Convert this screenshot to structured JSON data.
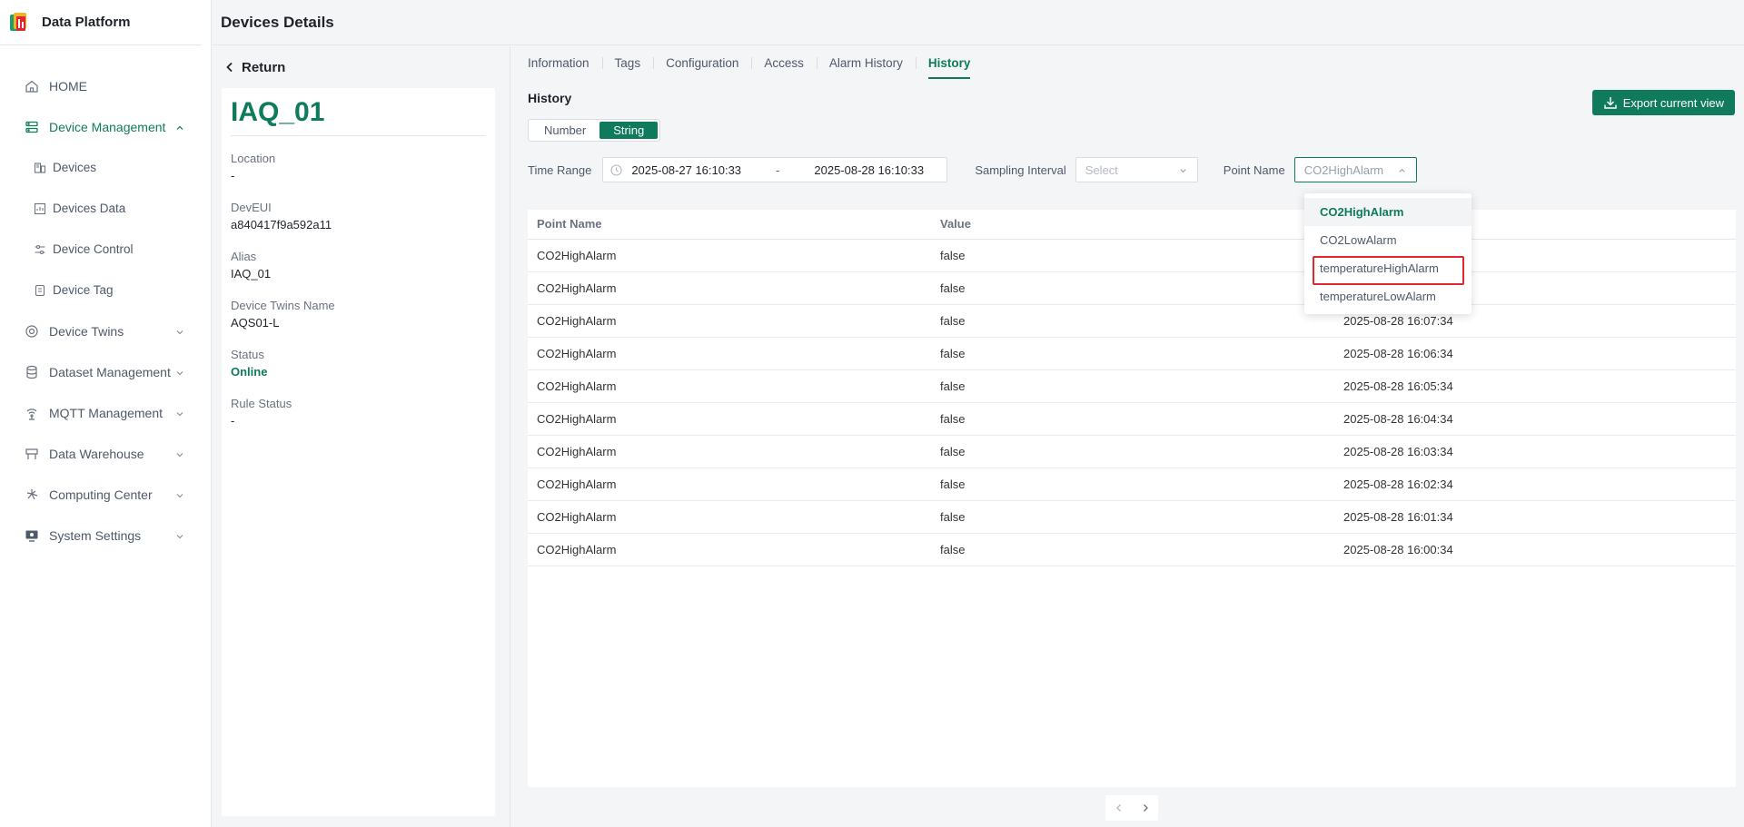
{
  "app": {
    "name": "Data Platform",
    "page_title": "Devices Details"
  },
  "colors": {
    "accent": "#0f7b5c",
    "highlight_box": "#e3262d"
  },
  "sidebar": {
    "items": [
      {
        "label": "HOME",
        "icon": "home-icon"
      },
      {
        "label": "Device Management",
        "icon": "device-management-icon",
        "active": true,
        "expanded": true,
        "children": [
          {
            "label": "Devices",
            "icon": "devices-icon"
          },
          {
            "label": "Devices Data",
            "icon": "devices-data-icon"
          },
          {
            "label": "Device Control",
            "icon": "device-control-icon"
          },
          {
            "label": "Device Tag",
            "icon": "device-tag-icon"
          }
        ]
      },
      {
        "label": "Device Twins",
        "icon": "device-twins-icon"
      },
      {
        "label": "Dataset Management",
        "icon": "dataset-icon"
      },
      {
        "label": "MQTT Management",
        "icon": "mqtt-icon"
      },
      {
        "label": "Data Warehouse",
        "icon": "warehouse-icon"
      },
      {
        "label": "Computing Center",
        "icon": "computing-icon"
      },
      {
        "label": "System Settings",
        "icon": "settings-icon"
      }
    ]
  },
  "device": {
    "return_label": "Return",
    "name": "IAQ_01",
    "fields": [
      {
        "label": "Location",
        "value": "-"
      },
      {
        "label": "DevEUI",
        "value": "a840417f9a592a11"
      },
      {
        "label": "Alias",
        "value": "IAQ_01"
      },
      {
        "label": "Device Twins Name",
        "value": "AQS01-L"
      },
      {
        "label": "Status",
        "value": "Online"
      },
      {
        "label": "Rule Status",
        "value": "-"
      }
    ]
  },
  "tabs": [
    "Information",
    "Tags",
    "Configuration",
    "Access",
    "Alarm History",
    "History"
  ],
  "active_tab": "History",
  "history": {
    "title": "History",
    "export_label": "Export current view",
    "type_options": [
      "Number",
      "String"
    ],
    "type_selected": "String",
    "time_range_label": "Time Range",
    "time_start": "2025-08-27 16:10:33",
    "time_sep": "-",
    "time_end": "2025-08-28 16:10:33",
    "sampling_label": "Sampling Interval",
    "sampling_placeholder": "Select",
    "point_name_label": "Point Name",
    "point_name_value": "CO2HighAlarm",
    "dropdown_options": [
      "CO2HighAlarm",
      "CO2LowAlarm",
      "temperatureHighAlarm",
      "temperatureLowAlarm"
    ],
    "dropdown_selected": "CO2HighAlarm",
    "dropdown_highlighted": "temperatureHighAlarm"
  },
  "table": {
    "columns": [
      "Point Name",
      "Value",
      ""
    ],
    "rows": [
      [
        "CO2HighAlarm",
        "false",
        ""
      ],
      [
        "CO2HighAlarm",
        "false",
        ""
      ],
      [
        "CO2HighAlarm",
        "false",
        "2025-08-28 16:07:34"
      ],
      [
        "CO2HighAlarm",
        "false",
        "2025-08-28 16:06:34"
      ],
      [
        "CO2HighAlarm",
        "false",
        "2025-08-28 16:05:34"
      ],
      [
        "CO2HighAlarm",
        "false",
        "2025-08-28 16:04:34"
      ],
      [
        "CO2HighAlarm",
        "false",
        "2025-08-28 16:03:34"
      ],
      [
        "CO2HighAlarm",
        "false",
        "2025-08-28 16:02:34"
      ],
      [
        "CO2HighAlarm",
        "false",
        "2025-08-28 16:01:34"
      ],
      [
        "CO2HighAlarm",
        "false",
        "2025-08-28 16:00:34"
      ]
    ]
  }
}
